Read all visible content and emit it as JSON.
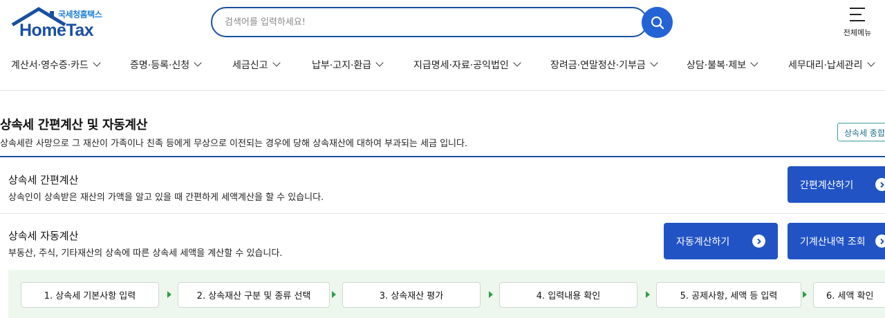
{
  "header": {
    "logo_sub": "국세청홈택스",
    "logo_main": "HomeTax",
    "search_placeholder": "검색어를 입력하세요!",
    "menu_label": "전체메뉴"
  },
  "nav": [
    {
      "label": "계산서·영수증·카드"
    },
    {
      "label": "증명·등록·신청"
    },
    {
      "label": "세금신고"
    },
    {
      "label": "납부·고지·환급"
    },
    {
      "label": "지급명세·자료·공익법인"
    },
    {
      "label": "장려금·연말정산·기부금"
    },
    {
      "label": "상담·불복·제보"
    },
    {
      "label": "세무대리·납세관리"
    }
  ],
  "page": {
    "title": "상속세 간편계산 및 자동계산",
    "description": "상속세란 사망으로 그 재산이 가족이나 친족 등에게 무상으로 이전되는 경우에 당해 상속재산에 대하여 부과되는 세금 입니다.",
    "summary_button": "상속세 종합"
  },
  "sections": {
    "simple": {
      "title": "상속세 간편계산",
      "description": "상속인이 상속받은 재산의 가액을 알고 있을 때 간편하게 세액계산을 할 수 있습니다.",
      "button": "간편계산하기"
    },
    "auto": {
      "title": "상속세 자동계산",
      "description": "부동산, 주식, 기타재산의 상속에 따른 상속세 세액을 계산할 수 있습니다.",
      "button_auto": "자동계산하기",
      "button_history": "기계산내역 조회"
    }
  },
  "steps": [
    {
      "label": "1. 상속세 기본사항 입력"
    },
    {
      "label": "2. 상속재산 구분 및 종류 선택"
    },
    {
      "label": "3. 상속재산 평가"
    },
    {
      "label": "4. 입력내용 확인"
    },
    {
      "label": "5. 공제사항, 세액 등 입력"
    },
    {
      "label": "6. 세액 확인"
    }
  ],
  "colors": {
    "brand_blue": "#1a4fa0",
    "button_blue": "#2153c4",
    "step_bg": "#eef7ee",
    "step_arrow": "#2f9d45"
  }
}
